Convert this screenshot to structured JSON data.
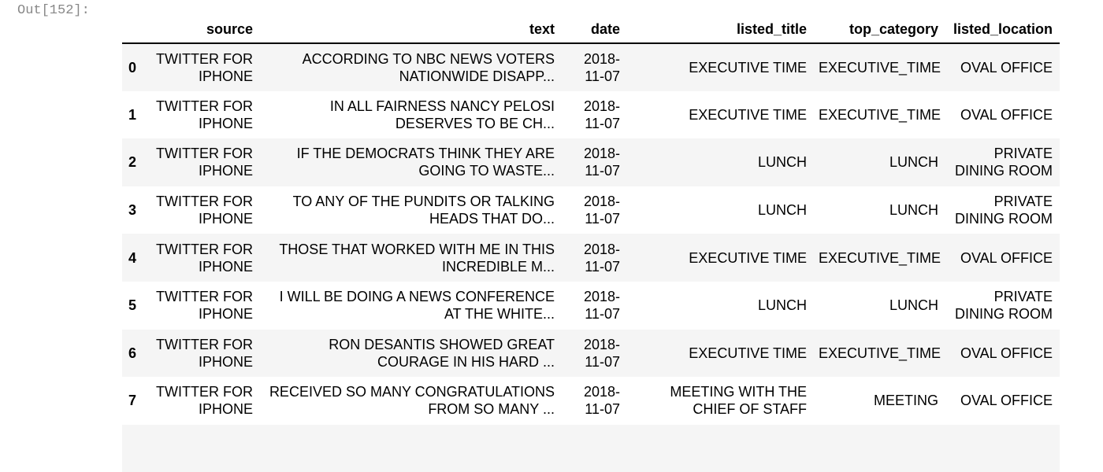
{
  "prompt": "Out[152]:",
  "columns": [
    "",
    "source",
    "text",
    "date",
    "listed_title",
    "top_category",
    "listed_location"
  ],
  "rows": [
    {
      "index": "0",
      "source": "TWITTER FOR IPHONE",
      "text": "ACCORDING TO NBC NEWS VOTERS NATIONWIDE DISAPP...",
      "date": "2018-11-07",
      "listed_title": "EXECUTIVE TIME",
      "top_category": "EXECUTIVE_TIME",
      "listed_location": "OVAL OFFICE"
    },
    {
      "index": "1",
      "source": "TWITTER FOR IPHONE",
      "text": "IN ALL FAIRNESS NANCY PELOSI DESERVES TO BE CH...",
      "date": "2018-11-07",
      "listed_title": "EXECUTIVE TIME",
      "top_category": "EXECUTIVE_TIME",
      "listed_location": "OVAL OFFICE"
    },
    {
      "index": "2",
      "source": "TWITTER FOR IPHONE",
      "text": "IF THE DEMOCRATS THINK THEY ARE GOING TO WASTE...",
      "date": "2018-11-07",
      "listed_title": "LUNCH",
      "top_category": "LUNCH",
      "listed_location": "PRIVATE DINING ROOM"
    },
    {
      "index": "3",
      "source": "TWITTER FOR IPHONE",
      "text": "TO ANY OF THE PUNDITS OR TALKING HEADS THAT DO...",
      "date": "2018-11-07",
      "listed_title": "LUNCH",
      "top_category": "LUNCH",
      "listed_location": "PRIVATE DINING ROOM"
    },
    {
      "index": "4",
      "source": "TWITTER FOR IPHONE",
      "text": "THOSE THAT WORKED WITH ME IN THIS INCREDIBLE M...",
      "date": "2018-11-07",
      "listed_title": "EXECUTIVE TIME",
      "top_category": "EXECUTIVE_TIME",
      "listed_location": "OVAL OFFICE"
    },
    {
      "index": "5",
      "source": "TWITTER FOR IPHONE",
      "text": "I WILL BE DOING A NEWS CONFERENCE AT THE WHITE...",
      "date": "2018-11-07",
      "listed_title": "LUNCH",
      "top_category": "LUNCH",
      "listed_location": "PRIVATE DINING ROOM"
    },
    {
      "index": "6",
      "source": "TWITTER FOR IPHONE",
      "text": "RON DESANTIS SHOWED GREAT COURAGE IN HIS HARD ...",
      "date": "2018-11-07",
      "listed_title": "EXECUTIVE TIME",
      "top_category": "EXECUTIVE_TIME",
      "listed_location": "OVAL OFFICE"
    },
    {
      "index": "7",
      "source": "TWITTER FOR IPHONE",
      "text": "RECEIVED SO MANY CONGRATULATIONS FROM SO MANY ...",
      "date": "2018-11-07",
      "listed_title": "MEETING WITH THE CHIEF OF STAFF",
      "top_category": "MEETING",
      "listed_location": "OVAL OFFICE"
    }
  ]
}
